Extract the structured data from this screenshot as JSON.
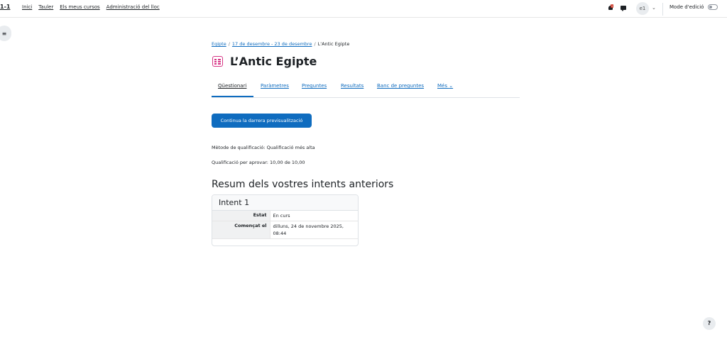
{
  "navbar": {
    "brand": "1-1",
    "items": [
      "Inici",
      "Tauler",
      "Els meus cursos",
      "Administració del lloc"
    ],
    "notification_count": "1",
    "avatar_initials": "e1",
    "edit_mode_label": "Mode d'edició"
  },
  "breadcrumb": {
    "items": [
      "Egipte",
      "17 de desembre - 23 de desembre",
      "L'Antic Egipte"
    ]
  },
  "page": {
    "title": "L’Antic Egipte"
  },
  "tabs": [
    "Qüestionari",
    "Paràmetres",
    "Preguntes",
    "Resultats",
    "Banc de preguntes",
    "Més"
  ],
  "actions": {
    "continue_preview": "Continua la darrera previsualització"
  },
  "info": {
    "grading_method": "Mètode de qualificació: Qualificació més alta",
    "pass_grade": "Qualificació per aprovar: 10,00 de 10,00"
  },
  "summary": {
    "heading": "Resum dels vostres intents anteriors",
    "attempt_title": "Intent 1",
    "rows": [
      {
        "label": "Estat",
        "value": "En curs"
      },
      {
        "label": "Començat el",
        "value": "dilluns, 24 de novembre 2025, 08:44"
      }
    ]
  },
  "help": "?"
}
